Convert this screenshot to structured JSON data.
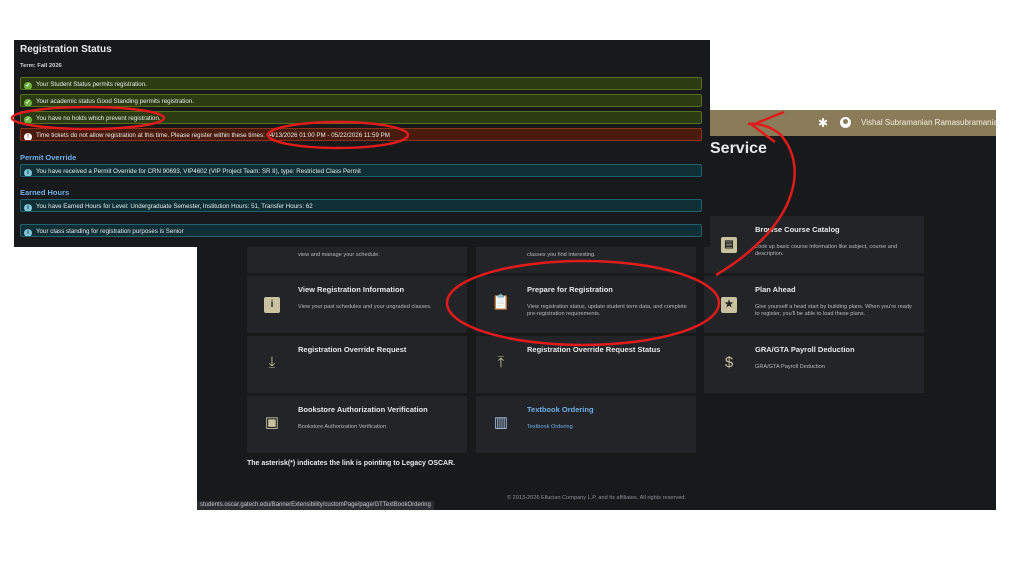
{
  "back": {
    "username": "Vishal Subramanian Ramasubramanian",
    "service_title": "Service",
    "cards": [
      {
        "title": "",
        "desc": "view and manage your schedule.",
        "icon": "calendar-icon",
        "link": false
      },
      {
        "title": "",
        "desc": "classes you find interesting.",
        "icon": "search-icon",
        "link": false
      },
      {
        "title": "Browse Course Catalog",
        "desc": "Look up basic course information like subject, course and description.",
        "icon": "book-icon",
        "link": false
      },
      {
        "title": "View Registration Information",
        "desc": "View your past schedules and your ungraded classes.",
        "icon": "info-icon",
        "link": false
      },
      {
        "title": "Prepare for Registration",
        "desc": "View registration status, update student term data, and complete pre-registration requirements.",
        "icon": "clipboard-icon",
        "link": false
      },
      {
        "title": "Plan Ahead",
        "desc": "Give yourself a head start by building plans. When you're ready to register, you'll be able to load these plans.",
        "icon": "calendar-star-icon",
        "link": false
      },
      {
        "title": "Registration Override Request",
        "desc": "",
        "icon": "download-tray-icon",
        "link": false
      },
      {
        "title": "Registration Override Request Status",
        "desc": "",
        "icon": "upload-tray-icon",
        "link": false
      },
      {
        "title": "GRA/GTA Payroll Deduction",
        "desc": "GRA/GTA Payroll Deduction",
        "icon": "dollar-hand-icon",
        "link": false
      },
      {
        "title": "Bookstore Authorization Verification",
        "desc": "Bookstore Authorization Verification",
        "icon": "box-book-icon",
        "link": false
      },
      {
        "title": "Textbook Ordering",
        "desc": "Textbook Ordering",
        "icon": "books-shelf-icon",
        "link": true
      }
    ],
    "asterisk_note": "The asterisk(*) indicates the link is pointing to Legacy OSCAR.",
    "copyright": "© 2013-2026 Ellucian Company L.P. and its affiliates. All rights reserved.",
    "status_url": "students.oscar.gatech.edu/BannerExtensibility/customPage/page/GTTextBookOrdering"
  },
  "front": {
    "title": "Registration Status",
    "term": "Term: Fall 2026",
    "status_messages": [
      {
        "type": "ok",
        "text": "Your Student Status permits registration."
      },
      {
        "type": "ok",
        "text": "Your academic status Good Standing permits registration."
      },
      {
        "type": "ok",
        "text": "You have no holds which prevent registration."
      },
      {
        "type": "err",
        "text": "Time tickets do not allow registration at this time. Please register within these times: 04/13/2026 01:00 PM - 05/22/2026 11:59 PM"
      }
    ],
    "permit_override": {
      "title": "Permit Override",
      "message": "You have received a Permit Override for CRN 90693, VIP4602 (VIP Project Team: SR II), type: Restricted Class Permit"
    },
    "earned_hours": {
      "title": "Earned Hours",
      "message": "You have Earned Hours for Level: Undergraduate Semester, Institution Hours: 51, Transfer Hours: 62"
    },
    "class_standing": "Your class standing for registration purposes is Senior"
  },
  "colors": {
    "annotation": "#e01b1b",
    "link": "#6fb0e8",
    "topbar": "#8a7c58"
  }
}
